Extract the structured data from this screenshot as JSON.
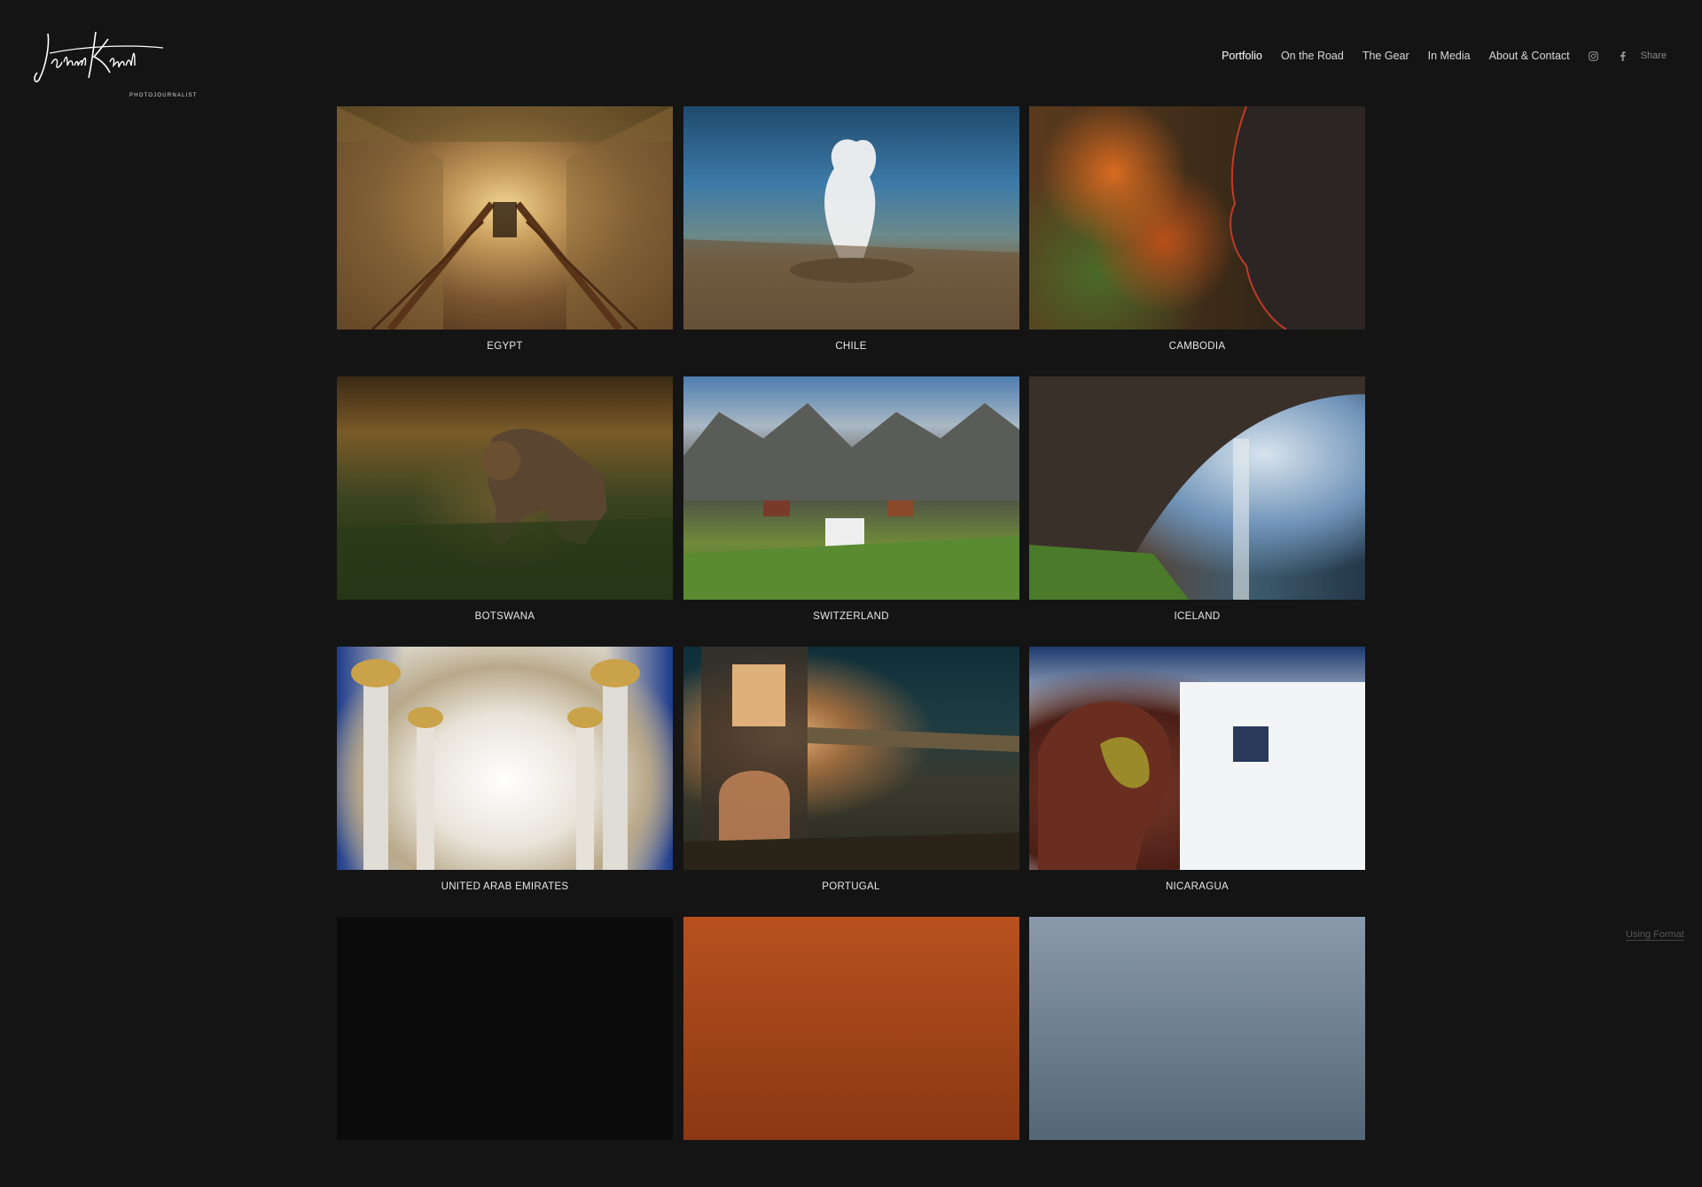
{
  "header": {
    "logo_text": "Jakub Kynčl",
    "logo_subtitle": "PHOTOJOURNALIST",
    "nav": [
      {
        "label": "Portfolio",
        "active": true
      },
      {
        "label": "On the Road",
        "active": false
      },
      {
        "label": "The Gear",
        "active": false
      },
      {
        "label": "In Media",
        "active": false
      },
      {
        "label": "About & Contact",
        "active": false
      }
    ],
    "icons": [
      "instagram-icon",
      "facebook-icon"
    ],
    "share_label": "Share"
  },
  "galleries": [
    {
      "caption": "EGYPT"
    },
    {
      "caption": "CHILE"
    },
    {
      "caption": "CAMBODIA"
    },
    {
      "caption": "BOTSWANA"
    },
    {
      "caption": "SWITZERLAND"
    },
    {
      "caption": "ICELAND"
    },
    {
      "caption": "UNITED ARAB EMIRATES"
    },
    {
      "caption": "PORTUGAL"
    },
    {
      "caption": "NICARAGUA"
    }
  ],
  "footer": {
    "using_format": "Using Format"
  },
  "colors": {
    "background": "#141414",
    "text": "#e6e6e6",
    "nav_muted": "#8a8a8a"
  }
}
